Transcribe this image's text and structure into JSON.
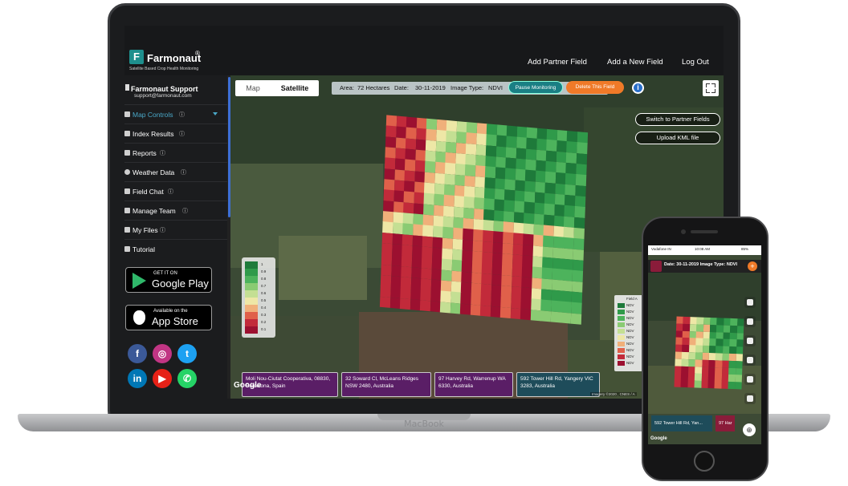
{
  "header": {
    "brand": "Farmonaut",
    "brand_mark": "®",
    "tagline": "Satellite Based Crop Health Monitoring",
    "nav": [
      "Add Partner Field",
      "Add a New Field",
      "Log Out"
    ]
  },
  "sidebar": {
    "support_name": "Farmonaut Support",
    "support_email": "support@farmonaut.com",
    "items": [
      {
        "label": "Map Controls",
        "info": "ⓘ"
      },
      {
        "label": "Index Results",
        "info": "ⓘ"
      },
      {
        "label": "Reports",
        "info": "ⓘ"
      },
      {
        "label": "Weather Data",
        "info": "ⓘ"
      },
      {
        "label": "Field Chat",
        "info": "ⓘ"
      },
      {
        "label": "Manage Team",
        "info": "ⓘ"
      },
      {
        "label": "My Files",
        "info": "ⓘ"
      },
      {
        "label": "Tutorial",
        "info": ""
      }
    ],
    "google_play": {
      "small": "GET IT ON",
      "big": "Google Play"
    },
    "app_store": {
      "small": "Available on the",
      "big": "App Store"
    },
    "social": [
      {
        "icon": "facebook-icon",
        "glyph": "f",
        "color": "#3b5998"
      },
      {
        "icon": "instagram-icon",
        "glyph": "◎",
        "color": "#c13584"
      },
      {
        "icon": "twitter-icon",
        "glyph": "t",
        "color": "#1da1f2"
      },
      {
        "icon": "linkedin-icon",
        "glyph": "in",
        "color": "#0077b5"
      },
      {
        "icon": "youtube-icon",
        "glyph": "▶",
        "color": "#e62117"
      },
      {
        "icon": "whatsapp-icon",
        "glyph": "✆",
        "color": "#25d366"
      }
    ]
  },
  "map": {
    "tabs": [
      "Map",
      "Satellite"
    ],
    "active_tab": "Satellite",
    "area_label": "Area:",
    "area_value": "72 Hectares",
    "date_label": "Date:",
    "date_value": "30-11-2019",
    "image_type_label": "Image Type:",
    "image_type_value": "NDVI",
    "pause_button": "Pause Monitoring",
    "delete_button": "Delete This Field",
    "switch_button": "Switch to Partner Fields",
    "upload_button": "Upload KML file",
    "legend_values": [
      "1",
      "0.9",
      "0.8",
      "0.7",
      "0.6",
      "0.5",
      "0.4",
      "0.3",
      "0.2",
      "0.1"
    ],
    "legend_colors": [
      "#1e7a3a",
      "#2f9a4a",
      "#4db35c",
      "#8acb73",
      "#c4df93",
      "#eee7a6",
      "#f0b07a",
      "#e0604a",
      "#c22a3a",
      "#9c1030"
    ],
    "right_legend_title": "Field A",
    "right_legend_items": [
      "NDV",
      "NDV",
      "NDV",
      "NDV",
      "NDV",
      "NDV",
      "NDV",
      "NDV",
      "NDV",
      "NDV"
    ],
    "address_cards": [
      {
        "text": "Moli Nou-Ciutat Cooperativa, 08830, Barcelona, Spain",
        "color": "#5a1e66"
      },
      {
        "text": "32 Soward Cl, McLeans Ridges NSW 2480, Australia",
        "color": "#5a1e66"
      },
      {
        "text": "97 Harvey Rd, Warrenup WA 6330, Australia",
        "color": "#5a1e66"
      },
      {
        "text": "592 Tower Hill Rd, Yangery VIC 3283, Australia",
        "color": "#1e4c5a"
      }
    ],
    "google": "Google",
    "imagery": "Imagery ©2020 , CNES / A"
  },
  "laptop_brand": "MacBook",
  "phone": {
    "carrier": "Vodafone IN",
    "time": "10:08 AM",
    "battery": "85%",
    "title": "Date: 30-11-2019 Image Type: NDVI",
    "card1": "592 Tower Hill Rd, Yan...",
    "card2": "97 Har",
    "google": "Google"
  }
}
